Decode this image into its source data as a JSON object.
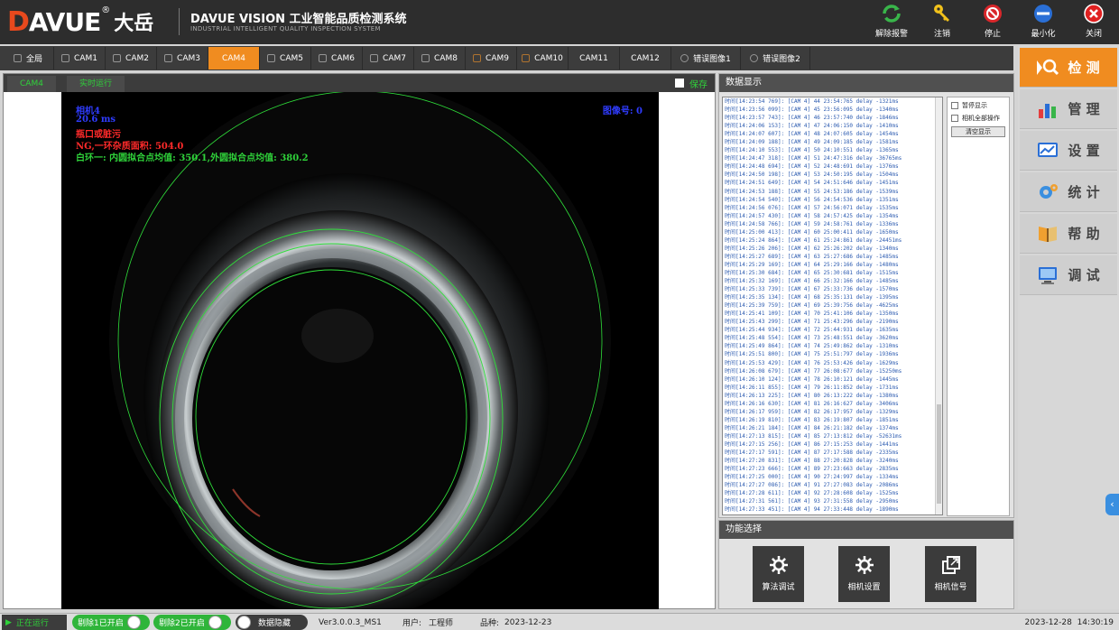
{
  "header": {
    "logo": {
      "d": "D",
      "word": "AVUE",
      "reg": "®",
      "cn": "大岳"
    },
    "title": "DAVUE VISION 工业智能品质检测系统",
    "subtitle": "INDUSTRIAL INTELLIGENT QUALITY INSPECTION SYSTEM",
    "buttons": [
      {
        "label": "解除报警",
        "icon": "refresh-icon"
      },
      {
        "label": "注销",
        "icon": "key-icon"
      },
      {
        "label": "停止",
        "icon": "stop-icon"
      },
      {
        "label": "最小化",
        "icon": "minimize-icon"
      },
      {
        "label": "关闭",
        "icon": "close-icon"
      }
    ]
  },
  "tabs": [
    {
      "label": "全局",
      "active": false
    },
    {
      "label": "CAM1",
      "active": false
    },
    {
      "label": "CAM2",
      "active": false
    },
    {
      "label": "CAM3",
      "active": false
    },
    {
      "label": "CAM4",
      "active": true
    },
    {
      "label": "CAM5",
      "active": false
    },
    {
      "label": "CAM6",
      "active": false
    },
    {
      "label": "CAM7",
      "active": false
    },
    {
      "label": "CAM8",
      "active": false
    },
    {
      "label": "CAM9",
      "active": false
    },
    {
      "label": "CAM10",
      "active": false
    },
    {
      "label": "CAM11",
      "active": false
    },
    {
      "label": "CAM12",
      "active": false
    },
    {
      "label": "错误图像1",
      "active": false
    },
    {
      "label": "错误图像2",
      "active": false
    }
  ],
  "camera_panel": {
    "subtabs": [
      "CAM4",
      "实时运行"
    ],
    "save_label": "保存",
    "overlay": {
      "line1": "相机4",
      "line2": "20.6 ms",
      "line3": "瓶口或脏污",
      "line4": "NG,一环杂质面积: 504.0",
      "line5": "白环一: 内圆拟合点均值: 350.1,外圆拟合点均值: 380.2",
      "image_no": "图像号: 0"
    },
    "colors": {
      "text_blue": "#2f3cff",
      "text_red": "#ff2a2a",
      "text_green": "#2fd23a",
      "circle": "#2fe03a"
    }
  },
  "data_panel": {
    "title": "数据显示",
    "options": [
      "暂停显示",
      "相机全部操作"
    ],
    "clear_label": "清空显示",
    "log": [
      "时间[14:23:54 769]: [CAM 4] 44 23:54:765 delay -1321ms",
      "时间[14:23:56 099]: [CAM 4] 45 23:56:095 delay -1340ms",
      "时间[14:23:57 743]: [CAM 4] 46 23:57:740 delay -1846ms",
      "时间[14:24:06 153]: [CAM 4] 47 24:06:150 delay -1410ms",
      "时间[14:24:07 607]: [CAM 4] 48 24:07:605 delay -1454ms",
      "时间[14:24:09 188]: [CAM 4] 49 24:09:185 delay -1581ms",
      "时间[14:24:10 553]: [CAM 4] 50 24:10:551 delay -1365ms",
      "时间[14:24:47 318]: [CAM 4] 51 24:47:316 delay -36765ms",
      "时间[14:24:48 694]: [CAM 4] 52 24:48:691 delay -1376ms",
      "时间[14:24:50 198]: [CAM 4] 53 24:50:195 delay -1504ms",
      "时间[14:24:51 649]: [CAM 4] 54 24:51:646 delay -1451ms",
      "时间[14:24:53 188]: [CAM 4] 55 24:53:186 delay -1539ms",
      "时间[14:24:54 540]: [CAM 4] 56 24:54:536 delay -1351ms",
      "时间[14:24:56 076]: [CAM 4] 57 24:56:071 delay -1535ms",
      "时间[14:24:57 430]: [CAM 4] 58 24:57:425 delay -1354ms",
      "时间[14:24:58 766]: [CAM 4] 59 24:58:761 delay -1336ms",
      "时间[14:25:00 413]: [CAM 4] 60 25:00:411 delay -1650ms",
      "时间[14:25:24 864]: [CAM 4] 61 25:24:861 delay -24451ms",
      "时间[14:25:26 206]: [CAM 4] 62 25:26:202 delay -1340ms",
      "时间[14:25:27 689]: [CAM 4] 63 25:27:686 delay -1485ms",
      "时间[14:25:29 169]: [CAM 4] 64 25:29:166 delay -1480ms",
      "时间[14:25:30 684]: [CAM 4] 65 25:30:681 delay -1515ms",
      "时间[14:25:32 169]: [CAM 4] 66 25:32:166 delay -1485ms",
      "时间[14:25:33 739]: [CAM 4] 67 25:33:736 delay -1570ms",
      "时间[14:25:35 134]: [CAM 4] 68 25:35:131 delay -1395ms",
      "时间[14:25:39 759]: [CAM 4] 69 25:39:756 delay -4625ms",
      "时间[14:25:41 109]: [CAM 4] 70 25:41:106 delay -1350ms",
      "时间[14:25:43 299]: [CAM 4] 71 25:43:296 delay -2190ms",
      "时间[14:25:44 934]: [CAM 4] 72 25:44:931 delay -1635ms",
      "时间[14:25:48 554]: [CAM 4] 73 25:48:551 delay -3620ms",
      "时间[14:25:49 864]: [CAM 4] 74 25:49:862 delay -1310ms",
      "时间[14:25:51 800]: [CAM 4] 75 25:51:797 delay -1936ms",
      "时间[14:25:53 429]: [CAM 4] 76 25:53:426 delay -1629ms",
      "时间[14:26:08 679]: [CAM 4] 77 26:08:677 delay -15250ms",
      "时间[14:26:10 124]: [CAM 4] 78 26:10:121 delay -1445ms",
      "时间[14:26:11 855]: [CAM 4] 79 26:11:852 delay -1731ms",
      "时间[14:26:13 225]: [CAM 4] 80 26:13:222 delay -1380ms",
      "时间[14:26:16 630]: [CAM 4] 81 26:16:627 delay -3406ms",
      "时间[14:26:17 959]: [CAM 4] 82 26:17:957 delay -1329ms",
      "时间[14:26:19 810]: [CAM 4] 83 26:19:807 delay -1851ms",
      "时间[14:26:21 184]: [CAM 4] 84 26:21:182 delay -1374ms",
      "时间[14:27:13 815]: [CAM 4] 85 27:13:812 delay -52631ms",
      "时间[14:27:15 256]: [CAM 4] 86 27:15:253 delay -1441ms",
      "时间[14:27:17 591]: [CAM 4] 87 27:17:588 delay -2335ms",
      "时间[14:27:20 831]: [CAM 4] 88 27:20:828 delay -3240ms",
      "时间[14:27:23 666]: [CAM 4] 89 27:23:663 delay -2835ms",
      "时间[14:27:25 000]: [CAM 4] 90 27:24:997 delay -1334ms",
      "时间[14:27:27 086]: [CAM 4] 91 27:27:083 delay -2086ms",
      "时间[14:27:28 611]: [CAM 4] 92 27:28:608 delay -1525ms",
      "时间[14:27:31 561]: [CAM 4] 93 27:31:558 delay -2950ms",
      "时间[14:27:33 451]: [CAM 4] 94 27:33:448 delay -1890ms"
    ]
  },
  "func_panel": {
    "title": "功能选择",
    "buttons": [
      {
        "label": "算法调试",
        "icon": "gear-icon"
      },
      {
        "label": "相机设置",
        "icon": "gear-icon"
      },
      {
        "label": "相机信号",
        "icon": "external-link-icon"
      }
    ]
  },
  "right_nav": [
    {
      "label": "检 测",
      "icon": "magnifier-icon",
      "active": true
    },
    {
      "label": "管 理",
      "icon": "bar-chart-icon",
      "active": false
    },
    {
      "label": "设 置",
      "icon": "monitor-chart-icon",
      "active": false
    },
    {
      "label": "统 计",
      "icon": "gears-icon",
      "active": false
    },
    {
      "label": "帮 助",
      "icon": "book-icon",
      "active": false
    },
    {
      "label": "调 试",
      "icon": "computer-icon",
      "active": false
    }
  ],
  "statusbar": {
    "running": "正在运行",
    "reject1": "剔除1已开启",
    "reject2": "剔除2已开启",
    "data_hide": "数据隐藏",
    "version": "Ver3.0.0.3_MS1",
    "user_label": "用户:",
    "user": "工程师",
    "product_label": "品种:",
    "product": "2023-12-23",
    "datetime": "2023-12-28  14:30:19"
  },
  "colors": {
    "accent": "#f08c20",
    "dark": "#2d2d2d",
    "green": "#2fd23a"
  }
}
